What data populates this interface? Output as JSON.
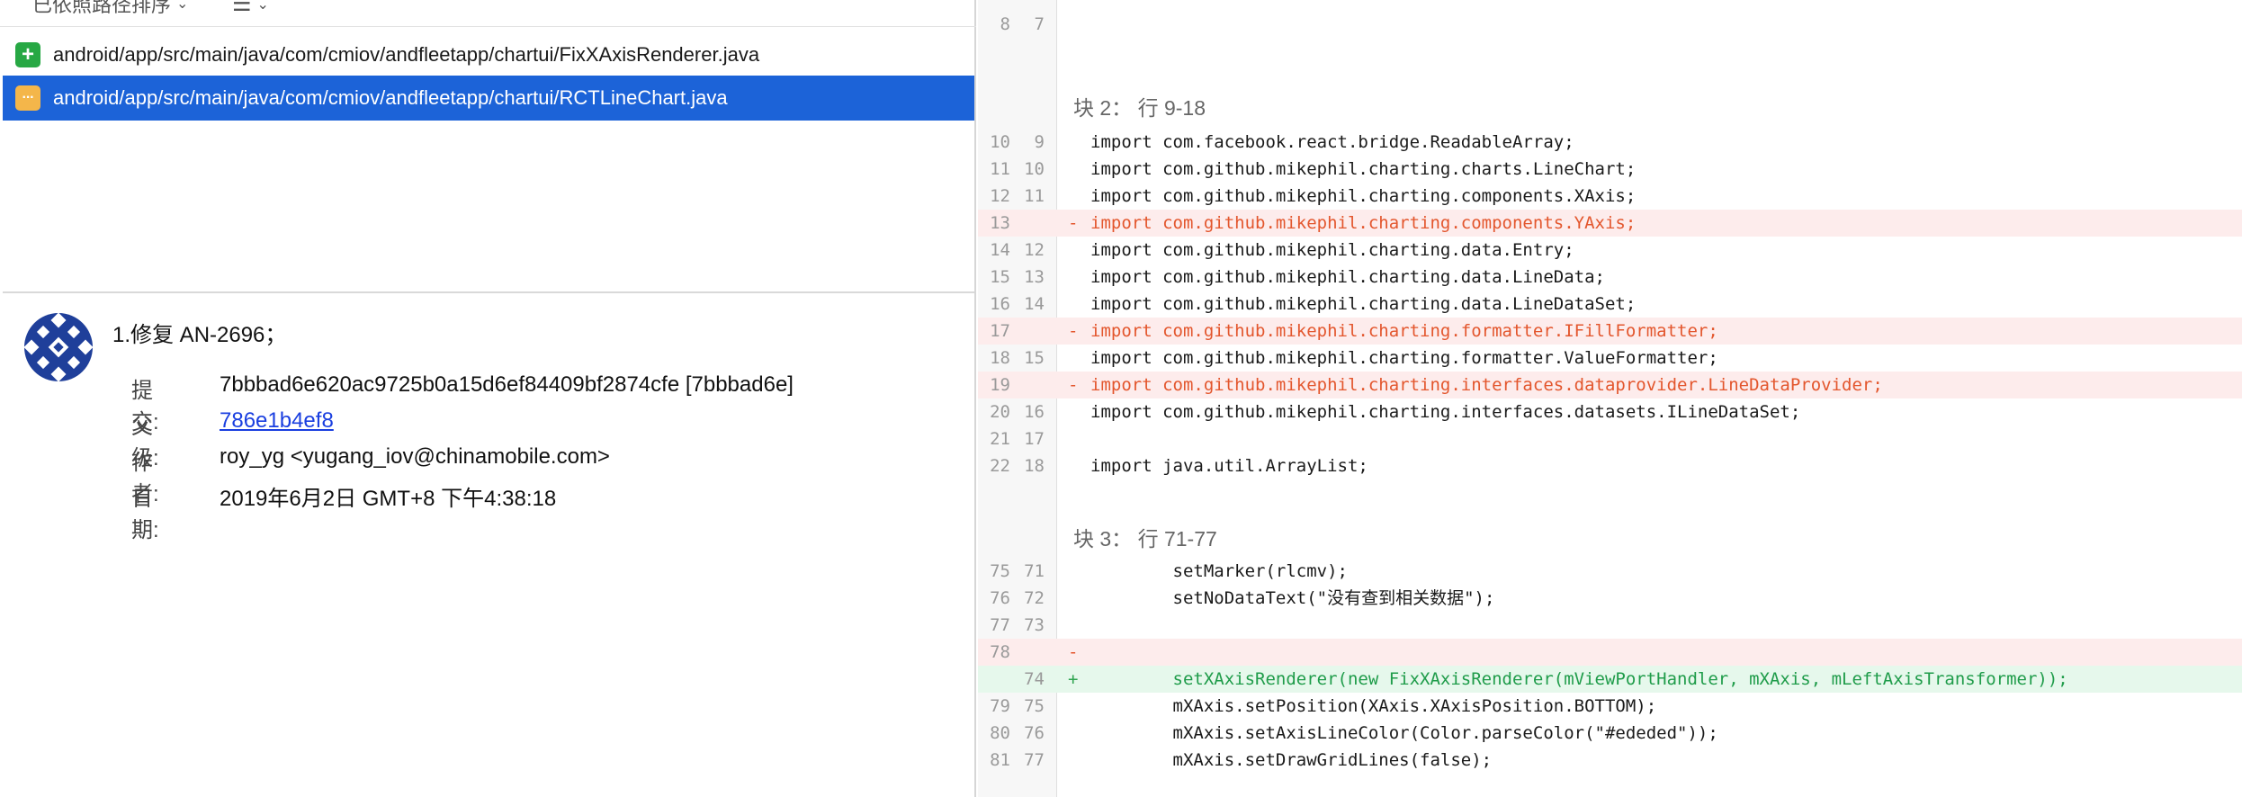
{
  "toolbar": {
    "sort_label": "已依照路径排序",
    "sort_chevron": "⌄",
    "list_icon": "☰",
    "list_chevron": "⌄"
  },
  "files": [
    {
      "status": "added",
      "status_icon": "+",
      "path": "android/app/src/main/java/com/cmiov/andfleetapp/chartui/FixXAxisRenderer.java"
    },
    {
      "status": "modified",
      "status_icon": "···",
      "path": "android/app/src/main/java/com/cmiov/andfleetapp/chartui/RCTLineChart.java"
    }
  ],
  "commit": {
    "message": "1.修复 AN-2696；",
    "labels": {
      "commit": "提交:",
      "parent": "父级:",
      "author": "作者:",
      "date": "日期:"
    },
    "hash": "7bbbad6e620ac9725b0a15d6ef84409bf2874cfe [7bbbad6e]",
    "parent": "786e1b4ef8",
    "author": "roy_yg <yugang_iov@chinamobile.com>",
    "date": "2019年6月2日 GMT+8 下午4:38:18"
  },
  "diff": {
    "top_line": {
      "old": "8",
      "new": "7"
    },
    "hunks": [
      {
        "title": "块 2： 行 9-18",
        "lines": [
          {
            "old": "10",
            "new": "9",
            "type": "ctx",
            "text": "import com.facebook.react.bridge.ReadableArray;"
          },
          {
            "old": "11",
            "new": "10",
            "type": "ctx",
            "text": "import com.github.mikephil.charting.charts.LineChart;"
          },
          {
            "old": "12",
            "new": "11",
            "type": "ctx",
            "text": "import com.github.mikephil.charting.components.XAxis;"
          },
          {
            "old": "13",
            "new": "",
            "type": "del",
            "text": "import com.github.mikephil.charting.components.YAxis;"
          },
          {
            "old": "14",
            "new": "12",
            "type": "ctx",
            "text": "import com.github.mikephil.charting.data.Entry;"
          },
          {
            "old": "15",
            "new": "13",
            "type": "ctx",
            "text": "import com.github.mikephil.charting.data.LineData;"
          },
          {
            "old": "16",
            "new": "14",
            "type": "ctx",
            "text": "import com.github.mikephil.charting.data.LineDataSet;"
          },
          {
            "old": "17",
            "new": "",
            "type": "del",
            "text": "import com.github.mikephil.charting.formatter.IFillFormatter;"
          },
          {
            "old": "18",
            "new": "15",
            "type": "ctx",
            "text": "import com.github.mikephil.charting.formatter.ValueFormatter;"
          },
          {
            "old": "19",
            "new": "",
            "type": "del",
            "text": "import com.github.mikephil.charting.interfaces.dataprovider.LineDataProvider;"
          },
          {
            "old": "20",
            "new": "16",
            "type": "ctx",
            "text": "import com.github.mikephil.charting.interfaces.datasets.ILineDataSet;"
          },
          {
            "old": "21",
            "new": "17",
            "type": "ctx",
            "text": ""
          },
          {
            "old": "22",
            "new": "18",
            "type": "ctx",
            "text": "import java.util.ArrayList;"
          }
        ]
      },
      {
        "title": "块 3： 行 71-77",
        "lines": [
          {
            "old": "75",
            "new": "71",
            "type": "ctx",
            "text": "        setMarker(rlcmv);"
          },
          {
            "old": "76",
            "new": "72",
            "type": "ctx",
            "text": "        setNoDataText(\"没有查到相关数据\");"
          },
          {
            "old": "77",
            "new": "73",
            "type": "ctx",
            "text": ""
          },
          {
            "old": "78",
            "new": "",
            "type": "del",
            "text": ""
          },
          {
            "old": "",
            "new": "74",
            "type": "add",
            "text": "        setXAxisRenderer(new FixXAxisRenderer(mViewPortHandler, mXAxis, mLeftAxisTransformer));"
          },
          {
            "old": "79",
            "new": "75",
            "type": "ctx",
            "text": "        mXAxis.setPosition(XAxis.XAxisPosition.BOTTOM);"
          },
          {
            "old": "80",
            "new": "76",
            "type": "ctx",
            "text": "        mXAxis.setAxisLineColor(Color.parseColor(\"#ededed\"));"
          },
          {
            "old": "81",
            "new": "77",
            "type": "ctx",
            "text": "        mXAxis.setDrawGridLines(false);"
          }
        ]
      }
    ],
    "marks": {
      "del": "-",
      "add": "+"
    }
  },
  "colors": {
    "selection": "#1c63d8",
    "added_badge": "#27a844",
    "modified_badge": "#f4b64a",
    "deleted_text": "#e3562d",
    "added_text": "#1f9c4a",
    "link": "#1a3fe0"
  }
}
